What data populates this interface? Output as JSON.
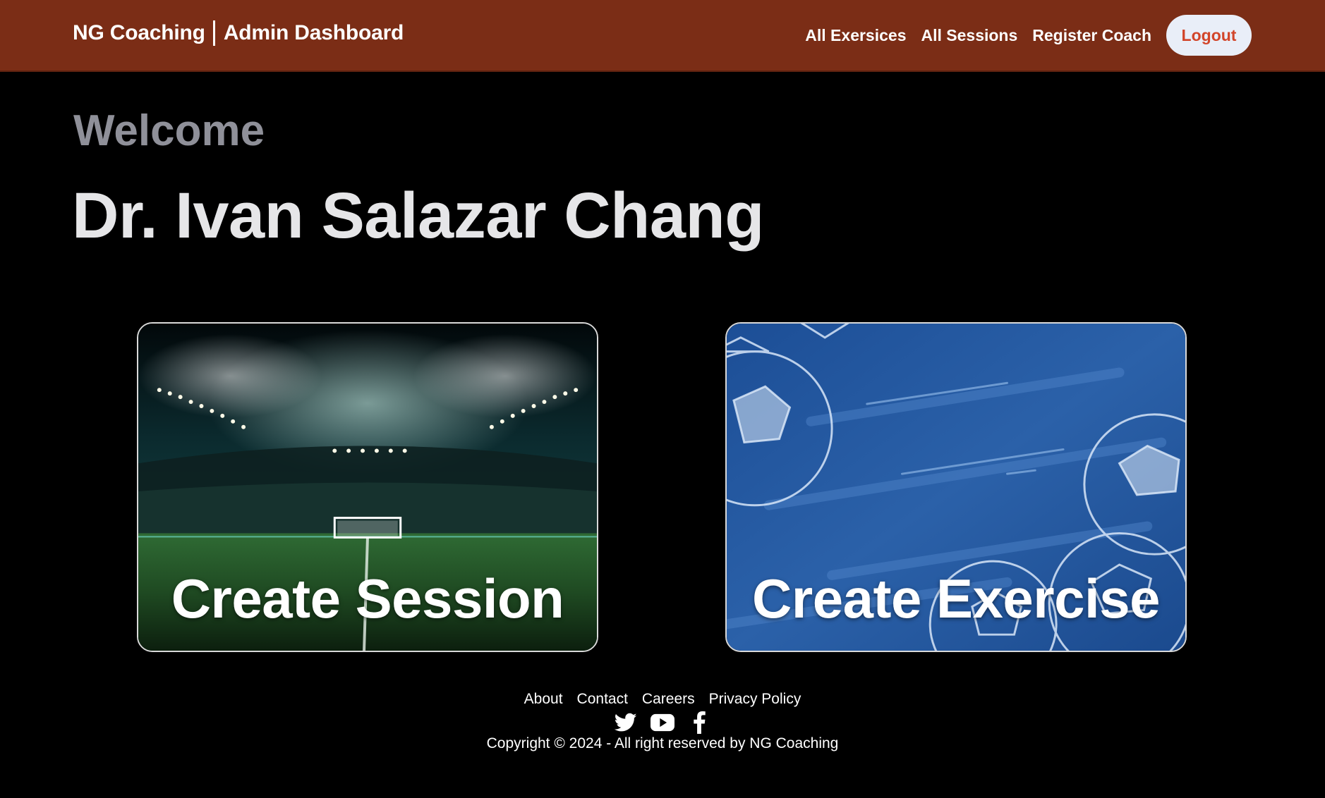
{
  "header": {
    "brand_left": "NG Coaching",
    "brand_right": "Admin Dashboard",
    "nav": [
      {
        "label": "All Exersices"
      },
      {
        "label": "All Sessions"
      },
      {
        "label": "Register Coach"
      }
    ],
    "logout_label": "Logout",
    "bg_color": "#7b2d16",
    "logout_text_color": "#d2452a"
  },
  "welcome": {
    "greeting": "Welcome",
    "user_name": "Dr. Ivan Salazar Chang"
  },
  "cards": [
    {
      "label": "Create Session",
      "image": "stadium-night-image"
    },
    {
      "label": "Create Exercise",
      "image": "blue-soccer-balls-image"
    }
  ],
  "footer": {
    "links": [
      {
        "label": "About"
      },
      {
        "label": "Contact"
      },
      {
        "label": "Careers"
      },
      {
        "label": "Privacy Policy"
      }
    ],
    "social": [
      {
        "icon": "twitter-icon"
      },
      {
        "icon": "youtube-icon"
      },
      {
        "icon": "facebook-icon"
      }
    ],
    "copyright": "Copyright © 2024 - All right reserved by NG Coaching"
  }
}
